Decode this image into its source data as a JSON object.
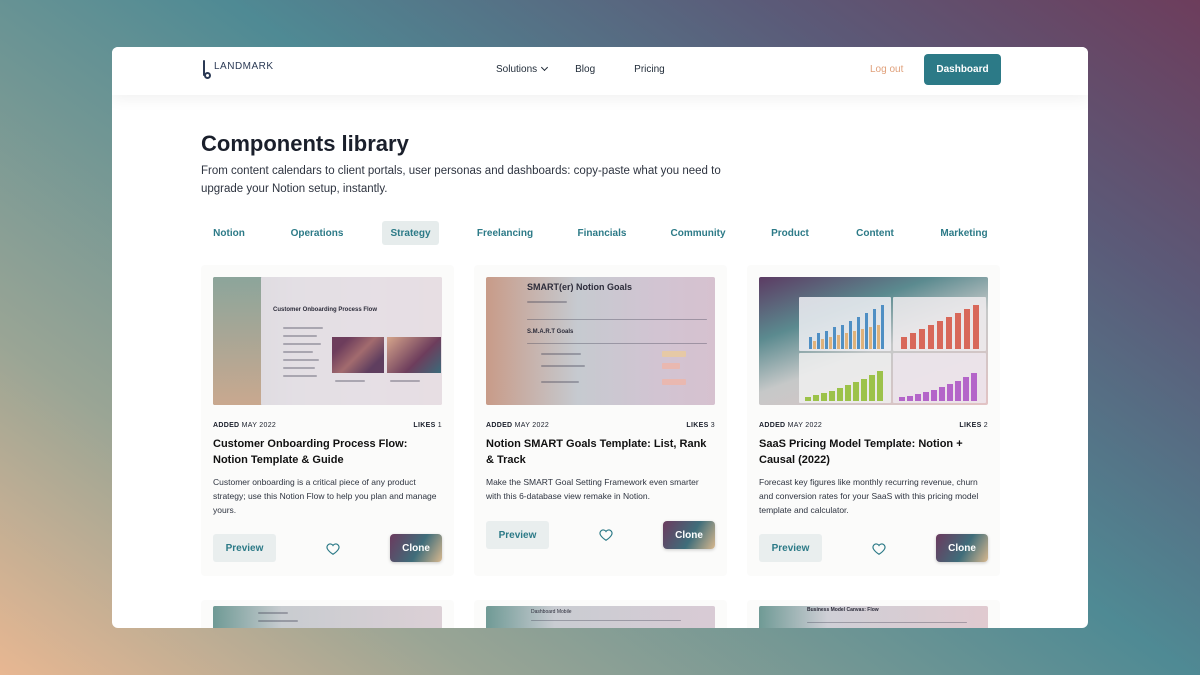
{
  "nav": {
    "logo_text": "LANDMARK",
    "links": [
      "Solutions",
      "Blog",
      "Pricing"
    ],
    "logout": "Log out",
    "dashboard": "Dashboard"
  },
  "hero": {
    "title": "Components library",
    "description": "From content calendars to client portals, user personas and dashboards: copy-paste what you need to upgrade your Notion setup, instantly."
  },
  "tabs": [
    "Notion",
    "Operations",
    "Strategy",
    "Freelancing",
    "Financials",
    "Community",
    "Product",
    "Content",
    "Marketing"
  ],
  "active_tab": "Strategy",
  "cards": [
    {
      "added_label": "ADDED",
      "added_date": "MAY 2022",
      "likes_label": "LIKES",
      "likes": "1",
      "title": "Customer Onboarding Process Flow: Notion Template & Guide",
      "description": "Customer onboarding is a critical piece of any product strategy; use this Notion Flow to help you plan and manage yours.",
      "preview": "Preview",
      "clone": "Clone",
      "thumb_title": "Customer Onboarding Process Flow"
    },
    {
      "added_label": "ADDED",
      "added_date": "MAY 2022",
      "likes_label": "LIKES",
      "likes": "3",
      "title": "Notion SMART Goals Template: List, Rank & Track",
      "description": "Make the SMART Goal Setting Framework even smarter with this 6-database view remake in Notion.",
      "preview": "Preview",
      "clone": "Clone",
      "thumb_title": "SMART(er) Notion Goals",
      "thumb_sub": "S.M.A.R.T Goals"
    },
    {
      "added_label": "ADDED",
      "added_date": "MAY 2022",
      "likes_label": "LIKES",
      "likes": "2",
      "title": "SaaS Pricing Model Template: Notion + Causal (2022)",
      "description": "Forecast key figures like monthly recurring revenue, churn and conversion rates for your SaaS with this pricing model template and calculator.",
      "preview": "Preview",
      "clone": "Clone"
    }
  ],
  "row2": [
    {
      "thumb_title": ""
    },
    {
      "thumb_title": "Dashboard Mobile"
    },
    {
      "thumb_title": "Business Model Canvas: Flow"
    }
  ],
  "colors": {
    "accent": "#2c7a87",
    "logout": "#e0a07a"
  },
  "icons": [
    "heart-icon",
    "chevron-down-icon"
  ]
}
